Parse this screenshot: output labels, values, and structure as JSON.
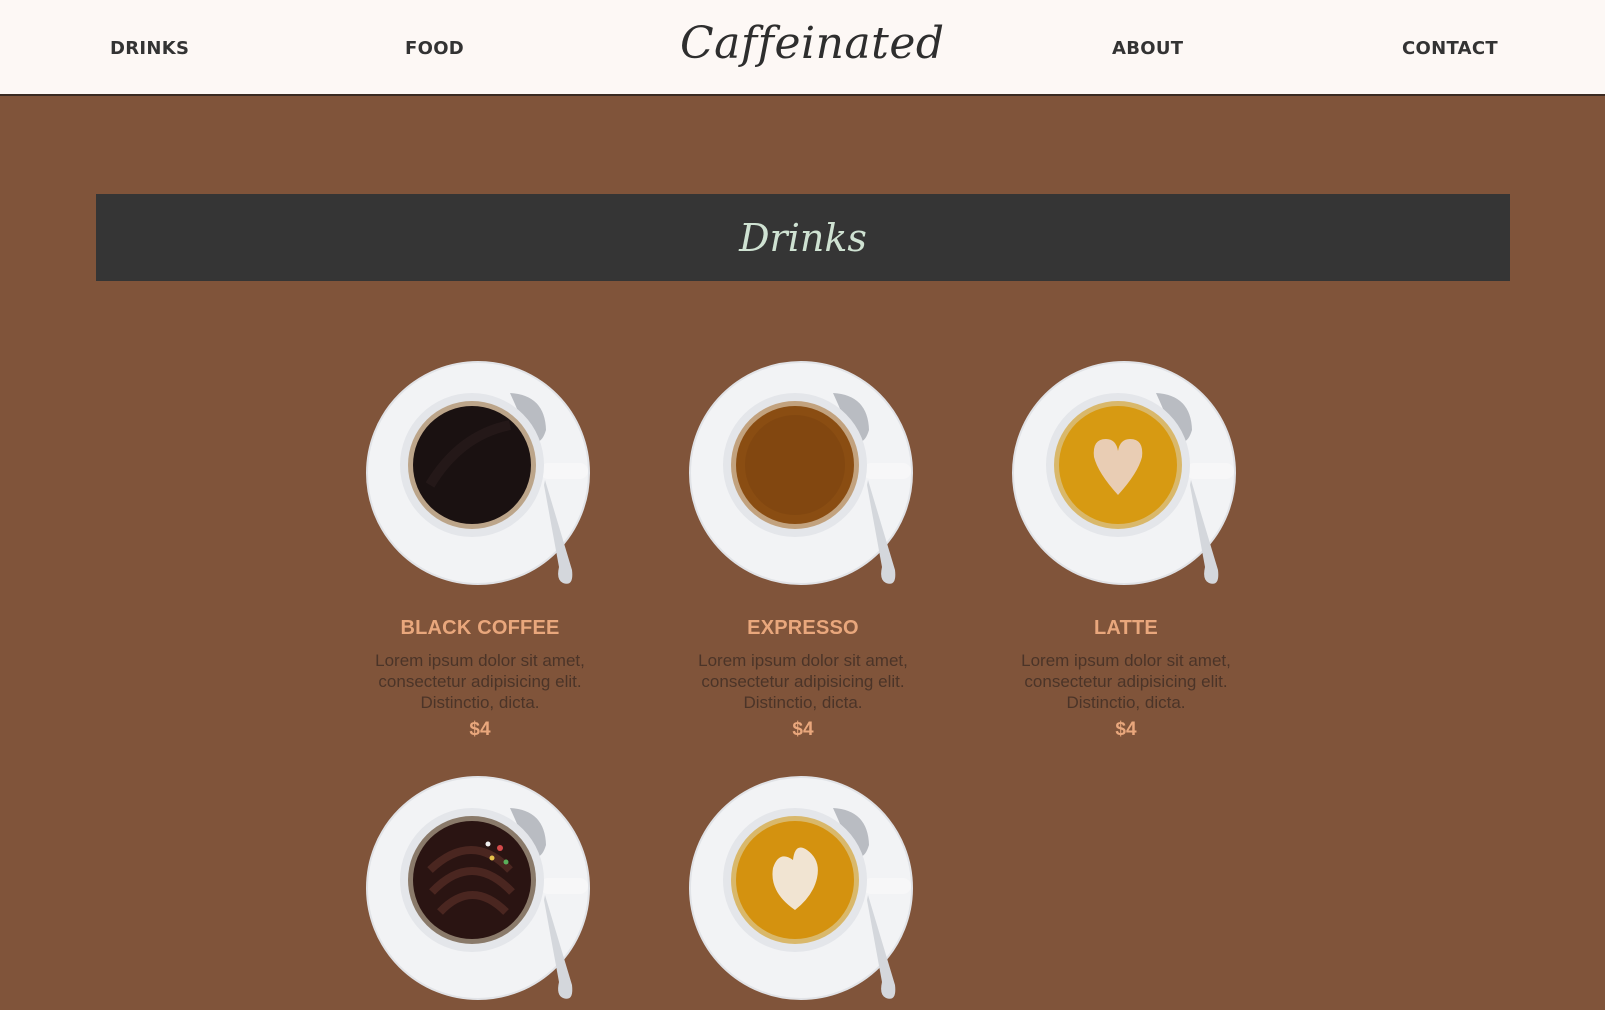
{
  "nav": {
    "drinks": "DRINKS",
    "food": "FOOD",
    "brand": "Caffeinated",
    "about": "ABOUT",
    "contact": "CONTACT"
  },
  "section": {
    "title": "Drinks"
  },
  "drinks": [
    {
      "name": "BLACK COFFEE",
      "description": "Lorem ipsum dolor sit amet, consectetur adipisicing elit. Distinctio, dicta.",
      "price": "$4"
    },
    {
      "name": "EXPRESSO",
      "description": "Lorem ipsum dolor sit amet, consectetur adipisicing elit. Distinctio, dicta.",
      "price": "$4"
    },
    {
      "name": "LATTE",
      "description": "Lorem ipsum dolor sit amet, consectetur adipisicing elit. Distinctio, dicta.",
      "price": "$4"
    }
  ],
  "colors": {
    "page_bg": "#80543a",
    "nav_bg": "#fdf8f5",
    "banner_bg": "#353535",
    "accent": "#e9a77c"
  }
}
